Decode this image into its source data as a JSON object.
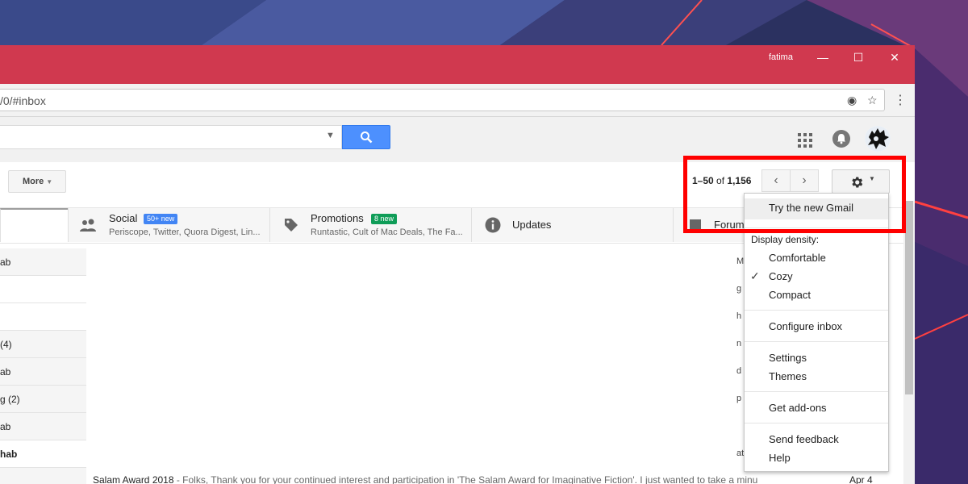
{
  "window": {
    "profile_name": "fatima",
    "minimize_glyph": "—",
    "maximize_glyph": "☐",
    "close_glyph": "✕"
  },
  "browser": {
    "url": "/0/#inbox",
    "eye_icon": "◉",
    "star_icon": "☆",
    "kebab_icon": "⋮"
  },
  "toolbar": {
    "more_label": "More",
    "caret": "▼",
    "page_range": "1–50",
    "page_of": "of",
    "page_total": "1,156",
    "prev_glyph": "‹",
    "next_glyph": "›"
  },
  "tabs": [
    {
      "title": "Social",
      "badge": "50+ new",
      "badge_color": "#4285f4",
      "subtitle": "Periscope, Twitter, Quora Digest, Lin..."
    },
    {
      "title": "Promotions",
      "badge": "8 new",
      "badge_color": "#0f9d58",
      "subtitle": "Runtastic, Cult of Mac Deals, The Fa..."
    },
    {
      "title": "Updates",
      "badge": "",
      "subtitle": ""
    },
    {
      "title": "Forum",
      "badge": "",
      "subtitle": ""
    }
  ],
  "inbox_left": [
    "ab",
    "",
    "",
    "(4)",
    "ab",
    "g (2)",
    "ab",
    "hab",
    ""
  ],
  "inbox_right_fragments": [
    "M",
    "g",
    "h",
    "n l",
    "d",
    "p",
    "",
    "",
    "at"
  ],
  "bottom_row": {
    "sender": "Salam Award 2018",
    "snippet": " - Folks, Thank you for your continued interest and participation in 'The Salam Award for Imaginative Fiction'. I just wanted to take a minu",
    "date": "Apr 4"
  },
  "settings_menu": {
    "try_new": "Try the new Gmail",
    "density_label": "Display density:",
    "density_options": [
      "Comfortable",
      "Cozy",
      "Compact"
    ],
    "selected_density": "Cozy",
    "check_glyph": "✓",
    "configure": "Configure inbox",
    "settings": "Settings",
    "themes": "Themes",
    "addons": "Get add-ons",
    "feedback": "Send feedback",
    "help": "Help"
  },
  "colors": {
    "titlebar": "#d0394f",
    "search_button": "#4d90fe",
    "annotation": "#ff0000"
  }
}
